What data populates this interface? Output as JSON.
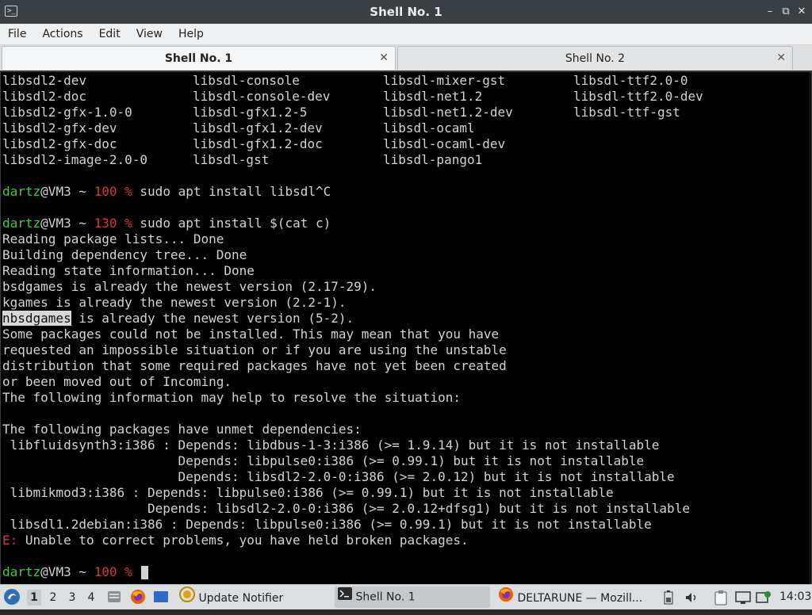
{
  "window": {
    "title": "Shell No. 1"
  },
  "menu": [
    "File",
    "Actions",
    "Edit",
    "View",
    "Help"
  ],
  "tabs": [
    {
      "label": "Shell No. 1",
      "active": true
    },
    {
      "label": "Shell No. 2",
      "active": false
    }
  ],
  "terminal": {
    "package_grid": [
      [
        "libsdl2-dev",
        "libsdl-console",
        "libsdl-mixer-gst",
        "libsdl-ttf2.0-0"
      ],
      [
        "libsdl2-doc",
        "libsdl-console-dev",
        "libsdl-net1.2",
        "libsdl-ttf2.0-dev"
      ],
      [
        "libsdl2-gfx-1.0-0",
        "libsdl-gfx1.2-5",
        "libsdl-net1.2-dev",
        "libsdl-ttf-gst"
      ],
      [
        "libsdl2-gfx-dev",
        "libsdl-gfx1.2-dev",
        "libsdl-ocaml",
        ""
      ],
      [
        "libsdl2-gfx-doc",
        "libsdl-gfx1.2-doc",
        "libsdl-ocaml-dev",
        ""
      ],
      [
        "libsdl2-image-2.0-0",
        "libsdl-gst",
        "libsdl-pango1",
        ""
      ]
    ],
    "prompt1": {
      "user": "dartz",
      "host": "@VM3 ~ ",
      "code": "100 %",
      "cmd": " sudo apt install libsdl^C"
    },
    "prompt2": {
      "user": "dartz",
      "host": "@VM3 ~ ",
      "code": "130 %",
      "cmd": " sudo apt install $(cat c)"
    },
    "out1": [
      "Reading package lists... Done",
      "Building dependency tree... Done",
      "Reading state information... Done",
      "bsdgames is already the newest version (2.17-29).",
      "kgames is already the newest version (2.2-1)."
    ],
    "highlight_word": "nbsdgames",
    "highlight_rest": " is already the newest version (5-2).",
    "out2": [
      "Some packages could not be installed. This may mean that you have",
      "requested an impossible situation or if you are using the unstable",
      "distribution that some required packages have not yet been created",
      "or been moved out of Incoming.",
      "The following information may help to resolve the situation:"
    ],
    "out3": [
      "The following packages have unmet dependencies:",
      " libfluidsynth3:i386 : Depends: libdbus-1-3:i386 (>= 1.9.14) but it is not installable",
      "                       Depends: libpulse0:i386 (>= 0.99.1) but it is not installable",
      "                       Depends: libsdl2-2.0-0:i386 (>= 2.0.12) but it is not installable",
      " libmikmod3:i386 : Depends: libpulse0:i386 (>= 0.99.1) but it is not installable",
      "                   Depends: libsdl2-2.0-0:i386 (>= 2.0.12+dfsg1) but it is not installable",
      " libsdl1.2debian:i386 : Depends: libpulse0:i386 (>= 0.99.1) but it is not installable"
    ],
    "error_prefix": "E:",
    "error_msg": " Unable to correct problems, you have held broken packages.",
    "prompt3": {
      "user": "dartz",
      "host": "@VM3 ~ ",
      "code": "100 %",
      "cmd": " "
    }
  },
  "taskbar": {
    "workspaces": [
      "1",
      "2",
      "3",
      "4"
    ],
    "tasks": [
      {
        "label": "Update Notifier",
        "icon": "update-notifier-icon"
      },
      {
        "label": "Shell No. 1",
        "icon": "terminal-icon",
        "active": true
      },
      {
        "label": "DELTARUNE — Mozill...",
        "icon": "firefox-icon"
      }
    ],
    "clock": "14:03"
  }
}
